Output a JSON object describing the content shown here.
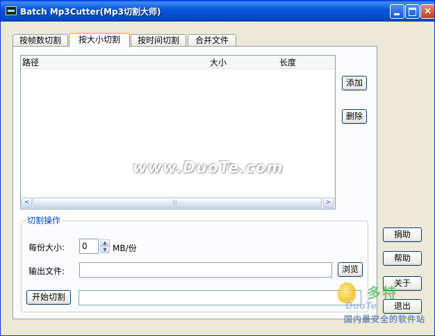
{
  "window": {
    "title": "Batch Mp3Cutter(Mp3切割大师)",
    "close_glyph": "×"
  },
  "tabs": [
    {
      "label": "按帧数切割",
      "active": false
    },
    {
      "label": "按大小切割",
      "active": true
    },
    {
      "label": "按时间切割",
      "active": false
    },
    {
      "label": "合并文件",
      "active": false
    }
  ],
  "file_list": {
    "columns": [
      "路径",
      "大小",
      "长度"
    ],
    "rows": [],
    "scroll_left_glyph": "<",
    "scroll_right_glyph": ">"
  },
  "list_buttons": {
    "add": "添加",
    "delete": "删除"
  },
  "operations": {
    "group_title": "切割操作",
    "size_label": "每份大小:",
    "size_value": "0",
    "size_unit": "MB/份",
    "output_label": "输出文件:",
    "output_value": "",
    "browse": "浏览",
    "start": "开始切割",
    "progress_value": "",
    "spin_up_glyph": "▲",
    "spin_down_glyph": "▼"
  },
  "side_buttons": {
    "donate": "捐助",
    "help": "帮助",
    "about": "关于",
    "exit": "退出"
  },
  "watermark": {
    "text": "www.DuoTe.com",
    "logo_text": "多特",
    "logo_brand": "DuoTe",
    "slogan": "国内最安全的软件站"
  }
}
